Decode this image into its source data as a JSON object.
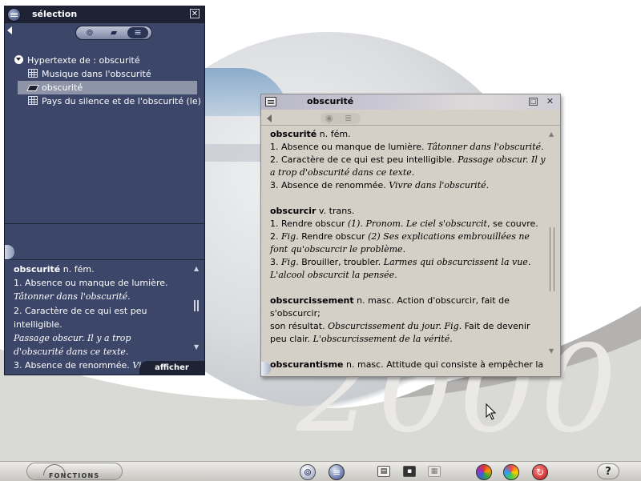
{
  "selection_panel": {
    "title": "sélection",
    "close_glyph": "✕",
    "toolbar_icons": [
      "hypertext-icon",
      "folder-icon",
      "list-icon"
    ],
    "tree": [
      {
        "label": "Hypertexte de : obscurité",
        "icon": "expand-disc-icon",
        "selected": false
      },
      {
        "label": "Musique dans l'obscurité",
        "icon": "grid-icon",
        "selected": false
      },
      {
        "label": "obscurité",
        "icon": "book-icon",
        "selected": true
      },
      {
        "label": "Pays du silence et de l'obscurité (le)",
        "icon": "grid-icon",
        "selected": false
      }
    ],
    "preview": {
      "headword": "obscurité",
      "pos": " n. fém.",
      "l1": "1. Absence ou manque de lumière.",
      "l1_ex": "Tâtonner dans l'obscurité.",
      "l2": "2. Caractère de ce qui est peu intelligible.",
      "l2_ex1": "Passage obscur. Il y a trop",
      "l2_ex2": "d'obscurité dans ce texte.",
      "l3": "3. Absence de renommée. ",
      "l3_ex": "Vivre dans"
    },
    "afficher_label": "afficher"
  },
  "definition_window": {
    "title": "obscurité",
    "min_glyph": "□",
    "close_glyph": "✕",
    "toolbar_icons": [
      "eye-icon",
      "list-icon"
    ],
    "entries": {
      "e1": {
        "head": "obscurité",
        "pos": " n. fém.",
        "s1": "1. Absence ou manque de lumière. ",
        "s1_ex": "Tâtonner dans l'obscurité",
        "s1_end": ".",
        "s2": "2. Caractère de ce qui est peu intelligible. ",
        "s2_ex1": "Passage obscur. Il y",
        "s2_ex2": "a trop d'obscurité dans ce texte",
        "s2_end": ".",
        "s3": "3. Absence de renommée. ",
        "s3_ex": "Vivre dans l'obscurité",
        "s3_end": "."
      },
      "e2": {
        "head": "obscurcir",
        "pos": " v. trans.",
        "s1": "1. Rendre obscur ",
        "s1_ex": "(1). Pronom. Le ciel s'obscurcit",
        "s1_end": ", se couvre.",
        "s2_pre": "2. ",
        "s2_fig": "Fig.",
        "s2": " Rendre obscur ",
        "s2_ex1": "(2) Ses explications embrouillées ne",
        "s2_ex2": "font qu'obscurcir le problème",
        "s2_end": ".",
        "s3_pre": "3. ",
        "s3_fig": "Fig.",
        "s3": " Brouiller, troubler. ",
        "s3_ex1": "Larmes qui obscurcissent la vue",
        "s3_end1": ".",
        "s3_ex2": "L'alcool obscurcit la pensée",
        "s3_end2": "."
      },
      "e3": {
        "head": "obscurcissement",
        "pos": " n. masc. Action d'obscurcir, fait de s'obscurcir;",
        "l2": "son résultat. ",
        "l2_ex": "Obscurcissement du jour. Fig.",
        "l2_end": " Fait de devenir",
        "l3": "peu clair. ",
        "l3_ex": "L'obscurcissement de la vérité",
        "l3_end": "."
      },
      "e4": {
        "head": "obscurantisme",
        "pos": " n. masc. Attitude qui consiste à empêcher la"
      }
    }
  },
  "background": {
    "year": "2000"
  },
  "taskbar": {
    "fonctions_label": "FONCTIONS",
    "help_glyph": "?",
    "icons": [
      "hypertext-icon",
      "list-icon",
      "card-icon",
      "window-icon",
      "image-icon",
      "color-wheel-icon",
      "palette-icon",
      "media-icon",
      "help-icon"
    ]
  },
  "colors": {
    "panel_bg": "#3b4668",
    "panel_title": "#1d2234",
    "selected_row": "#8e94a8",
    "window_bg": "#d4d0c8"
  }
}
